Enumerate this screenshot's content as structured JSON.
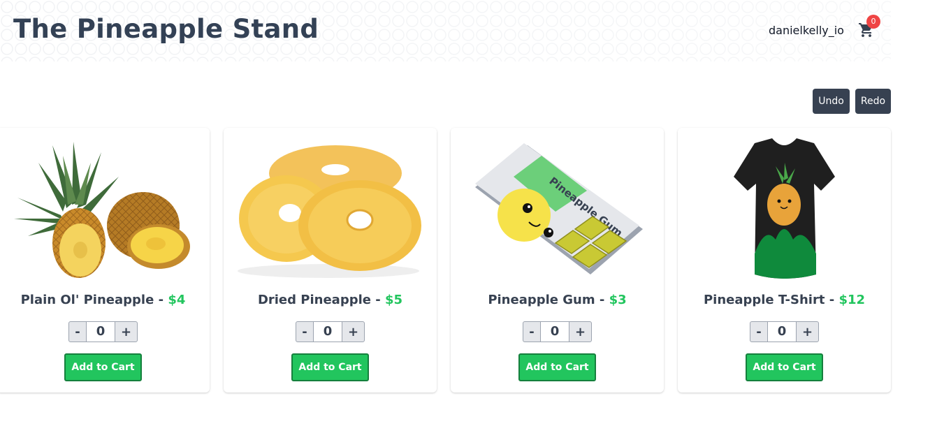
{
  "header": {
    "title": "The Pineapple Stand",
    "username": "danielkelly_io",
    "cart_icon": "shopping-cart-icon",
    "cart_count": "0"
  },
  "history": {
    "undo_label": "Undo",
    "redo_label": "Redo"
  },
  "colors": {
    "accent": "#22c55e",
    "dark": "#374151",
    "badge": "#ef4444"
  },
  "products": [
    {
      "name": "Plain Ol' Pineapple",
      "separator": " - ",
      "price": "$4",
      "quantity": "0",
      "minus": "-",
      "plus": "+",
      "add_label": "Add to Cart"
    },
    {
      "name": "Dried Pineapple",
      "separator": " - ",
      "price": "$5",
      "quantity": "0",
      "minus": "-",
      "plus": "+",
      "add_label": "Add to Cart"
    },
    {
      "name": "Pineapple Gum",
      "separator": " - ",
      "price": "$3",
      "quantity": "0",
      "minus": "-",
      "plus": "+",
      "add_label": "Add to Cart",
      "image_text": "Pineapple Gum"
    },
    {
      "name": "Pineapple T-Shirt",
      "separator": " - ",
      "price": "$12",
      "quantity": "0",
      "minus": "-",
      "plus": "+",
      "add_label": "Add to Cart"
    }
  ]
}
